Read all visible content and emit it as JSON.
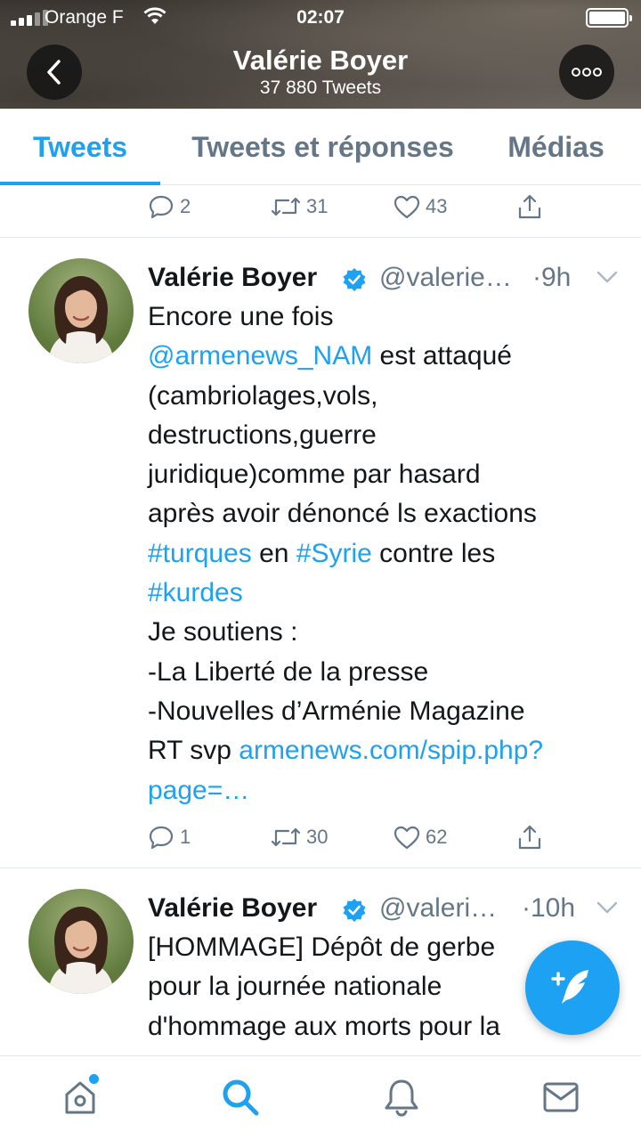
{
  "status_bar": {
    "carrier": "Orange F",
    "time": "02:07",
    "signal_icon": "signal-bars-icon",
    "wifi_icon": "wifi-icon",
    "battery_icon": "battery-icon"
  },
  "profile": {
    "name": "Valérie Boyer",
    "tweet_count": "37 880 Tweets"
  },
  "tabs": [
    {
      "label": "Tweets",
      "active": true
    },
    {
      "label": "Tweets et réponses",
      "active": false
    },
    {
      "label": "Médias",
      "active": false
    }
  ],
  "previous_tweet_actions": {
    "replies": "2",
    "retweets": "31",
    "likes": "43"
  },
  "tweets": [
    {
      "name": "Valérie Boyer",
      "handle": "@valerie…",
      "time": "·9h",
      "lines": [
        [
          {
            "t": "Encore une fois"
          }
        ],
        [
          {
            "t": "@armenews_NAM",
            "link": true
          },
          {
            "t": " est attaqué"
          }
        ],
        [
          {
            "t": "(cambriolages,vols,"
          }
        ],
        [
          {
            "t": "destructions,guerre"
          }
        ],
        [
          {
            "t": "juridique)comme par hasard"
          }
        ],
        [
          {
            "t": "après avoir dénoncé ls exactions"
          }
        ],
        [
          {
            "t": "#turques",
            "link": true
          },
          {
            "t": " en "
          },
          {
            "t": "#Syrie",
            "link": true
          },
          {
            "t": " contre les"
          }
        ],
        [
          {
            "t": "#kurdes",
            "link": true
          }
        ],
        [
          {
            "t": "Je soutiens :"
          }
        ],
        [
          {
            "t": "-La Liberté de la presse"
          }
        ],
        [
          {
            "t": "-Nouvelles d’Arménie Magazine"
          }
        ],
        [
          {
            "t": "RT svp "
          },
          {
            "t": "armenews.com/spip.php?",
            "link": true
          }
        ],
        [
          {
            "t": "page=…",
            "link": true
          }
        ]
      ],
      "replies": "1",
      "retweets": "30",
      "likes": "62"
    },
    {
      "name": "Valérie Boyer",
      "handle": "@valeri…",
      "time": "·10h",
      "lines": [
        [
          {
            "t": "[HOMMAGE] Dépôt de gerbe"
          }
        ],
        [
          {
            "t": "pour la journée nationale"
          }
        ],
        [
          {
            "t": "d'hommage aux morts pour la"
          }
        ]
      ]
    }
  ],
  "bottom_nav": [
    "home-icon",
    "search-icon",
    "notifications-bell-icon",
    "messages-envelope-icon"
  ],
  "colors": {
    "accent": "#1da1f2",
    "secondary_text": "#657786",
    "primary_text": "#14171a",
    "divider": "#e1e8ed"
  }
}
